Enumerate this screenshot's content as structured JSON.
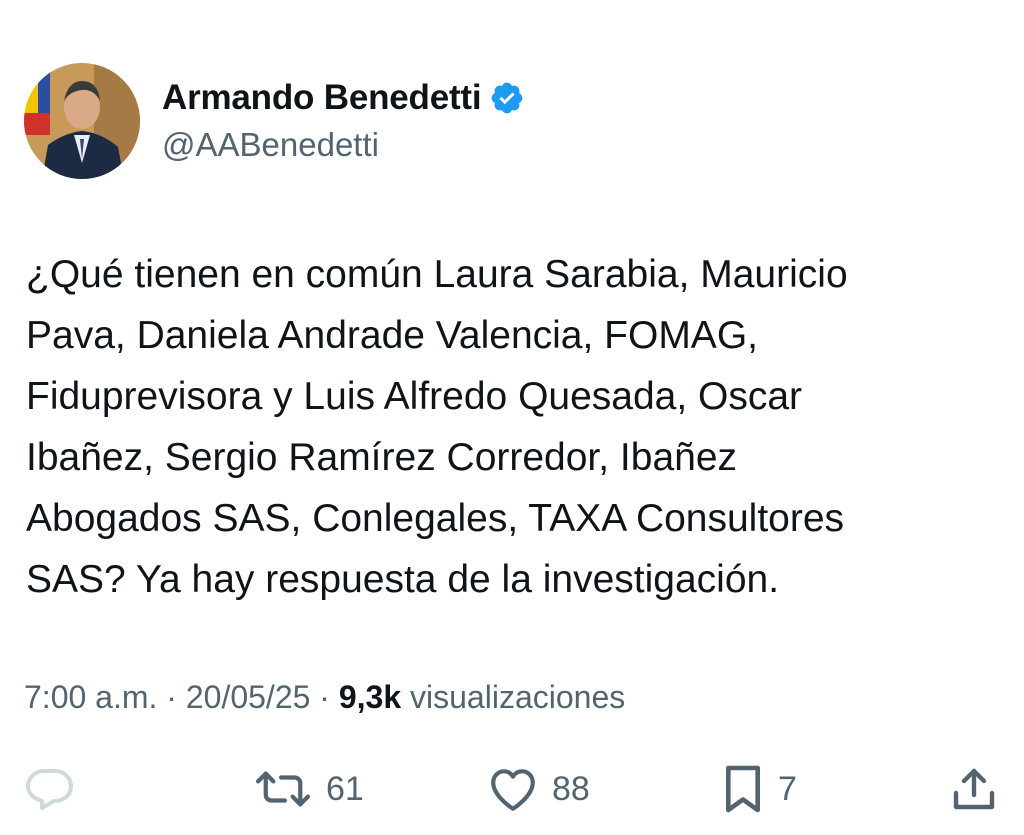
{
  "author": {
    "display_name": "Armando Benedetti",
    "handle": "@AABenedetti",
    "verified": true
  },
  "tweet": {
    "lines": [
      "¿Qué tienen en común Laura Sarabia, Mauricio",
      "Pava, Daniela Andrade Valencia, FOMAG,",
      "Fiduprevisora y Luis Alfredo Quesada, Oscar",
      "Ibañez, Sergio Ramírez Corredor, Ibañez",
      "Abogados SAS, Conlegales, TAXA Consultores",
      "SAS? Ya hay respuesta de la investigación."
    ]
  },
  "meta": {
    "time": "7:00 a.m.",
    "separator": "·",
    "date": "20/05/25",
    "views_count": "9,3k",
    "views_label": "visualizaciones"
  },
  "actions": {
    "reply_icon": "reply-icon",
    "retweet_icon": "retweet-icon",
    "retweet_count": "61",
    "like_icon": "heart-icon",
    "like_count": "88",
    "bookmark_icon": "bookmark-icon",
    "bookmark_count": "7",
    "share_icon": "share-icon"
  },
  "colors": {
    "text": "#0f1419",
    "secondary": "#536471",
    "verified": "#1d9bf0",
    "reply_icon_faded": "#cfd9de"
  }
}
